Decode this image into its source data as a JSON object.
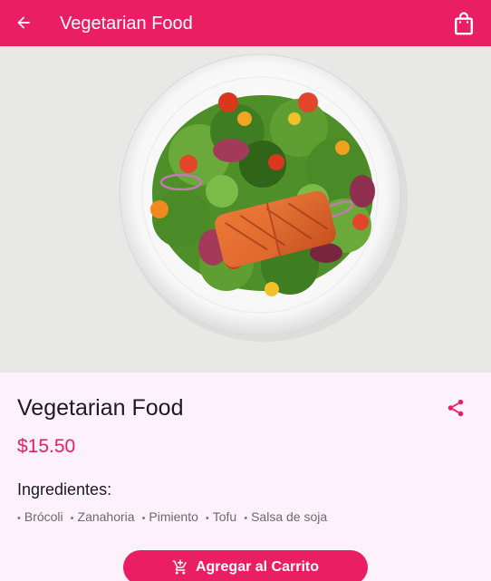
{
  "app_bar": {
    "title": "Vegetarian Food",
    "back_icon": "arrow-left-icon",
    "cart_icon": "shopping-bag-icon",
    "background": "#e91e63"
  },
  "hero": {
    "image": "salmon-salad-plate",
    "background": "#e8e8e7"
  },
  "product": {
    "title": "Vegetarian Food",
    "price": "$15.50",
    "share_icon": "share-icon",
    "accent": "#e91e63"
  },
  "ingredients": {
    "heading": "Ingredientes:",
    "items": [
      "Brócoli",
      "Zanahoria",
      "Pimiento",
      "Tofu",
      "Salsa de soja"
    ]
  },
  "cart_button": {
    "label": "Agregar al Carrito",
    "icon": "add-shopping-cart-icon"
  }
}
